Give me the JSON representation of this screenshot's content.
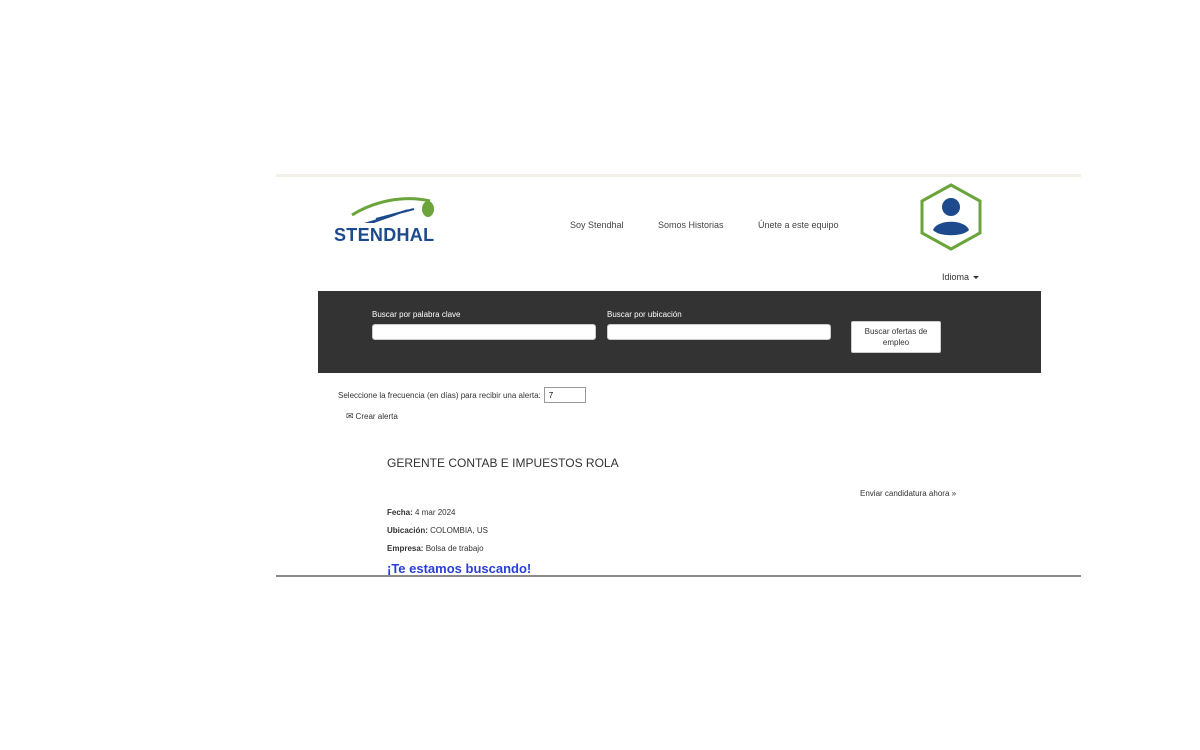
{
  "header": {
    "logo_text": "STENDHAL",
    "nav": [
      {
        "label": "Soy Stendhal"
      },
      {
        "label": "Somos Historias"
      },
      {
        "label": "Únete a este equipo"
      }
    ],
    "language_label": "Idioma"
  },
  "search": {
    "keyword_label": "Buscar por palabra clave",
    "keyword_value": "",
    "location_label": "Buscar por ubicación",
    "location_value": "",
    "button_label": "Buscar ofertas de empleo"
  },
  "alert": {
    "frequency_label": "Seleccione la frecuencia (en días) para recibir una alerta:",
    "frequency_value": "7",
    "create_label": "Crear alerta"
  },
  "job": {
    "title": "GERENTE CONTAB E IMPUESTOS ROLA",
    "apply_label": "Enviar candidatura ahora »",
    "date_label": "Fecha:",
    "date_value": "4 mar 2024",
    "location_label": "Ubicación:",
    "location_value": "COLOMBIA, US",
    "company_label": "Empresa:",
    "company_value": "Bolsa de trabajo",
    "promo_text": "¡Te estamos buscando!"
  },
  "icons": {
    "logo": "stendhal-swoosh-logo",
    "avatar": "user-avatar-icon",
    "language": "chevron-down-icon",
    "alert": "envelope-icon"
  },
  "colors": {
    "brand_blue": "#1c4a8c",
    "brand_green": "#6aa43a",
    "search_bar_bg": "#333333",
    "promo_blue": "#2a3fd6"
  }
}
